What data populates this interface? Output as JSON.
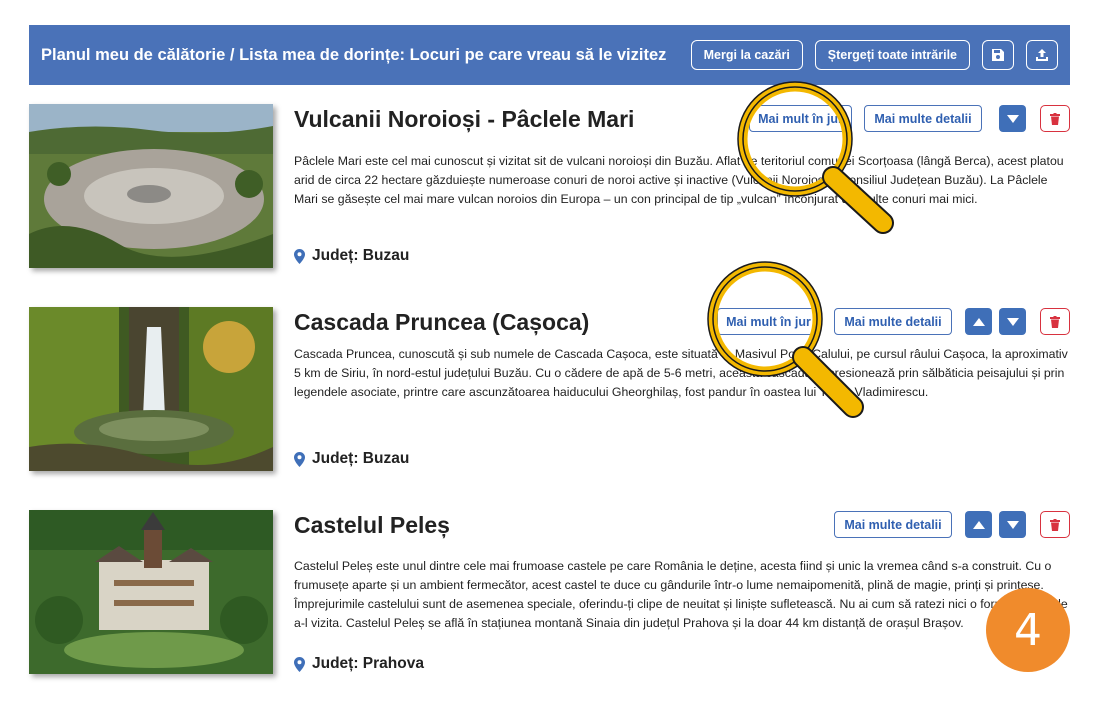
{
  "header": {
    "title": "Planul meu de călătorie / Lista mea de dorințe: Locuri pe care vreau să le vizitez",
    "goto_accommodation": "Mergi la cazări",
    "clear_all": "Ștergeți toate intrările",
    "save_icon": "save-icon",
    "export_icon": "export-icon"
  },
  "entries": [
    {
      "name": "Vulcanii Noroioși - Pâclele Mari",
      "nearby_label": "Mai mult în jur",
      "details_label": "Mai multe detalii",
      "description": "Pâclele Mari este cel mai cunoscut și vizitat sit de vulcani noroioși din Buzău. Aflat pe teritoriul comunei Scorțoasa (lângă Berca), acest platou arid de circa 22 hectare găzduiește numeroase conuri de noroi active și inactive (Vulcanii Noroioși – Consiliul Județean Buzău). La Pâclele Mari se găsește cel mai mare vulcan noroios din Europa – un con principal de tip „vulcan” înconjurat de multe conuri mai mici.",
      "county": "Județ: Buzau"
    },
    {
      "name": "Cascada Pruncea (Cașoca)",
      "nearby_label": "Mai mult în jur",
      "details_label": "Mai multe detalii",
      "description": "Cascada Pruncea, cunoscută și sub numele de Cascada Cașoca, este situată în Masivul Podu Calului, pe cursul râului Cașoca, la aproximativ 5 km de Siriu, în nord-estul județului Buzău. Cu o cădere de apă de 5-6 metri, această cascadă impresionează prin sălbăticia peisajului și prin legendele asociate, printre care ascunzătoarea haiducului Gheorghilaș, fost pandur în oastea lui Tudor Vladimirescu.",
      "county": "Județ: Buzau"
    },
    {
      "name": "Castelul Peleș",
      "details_label": "Mai multe detalii",
      "description": "Castelul Peleș este unul dintre cele mai frumoase castele pe care România le deține, acesta fiind și unic la vremea când s-a construit. Cu o frumusețe aparte și un ambient fermecător, acest castel te duce cu gândurile într-o lume nemaipomenită, plină de magie, prinți și prințese. Împrejurimile castelului sunt de asemenea speciale, oferindu-ți clipe de neuitat și liniște sufletească. Nu ai cum să ratezi nici o formă ocazia de a-l vizita. Castelul Peleș se află în stațiunea montană Sinaia din județul Prahova și la doar 44 km distanță de orașul Brașov.",
      "county": "Județ: Prahova"
    }
  ],
  "step_badge": "4",
  "colors": {
    "header_bg": "#4a72b8",
    "accent": "#3f6fb8",
    "danger": "#d8323f",
    "magnifier": "#f3b800",
    "badge": "#f08b2c"
  }
}
